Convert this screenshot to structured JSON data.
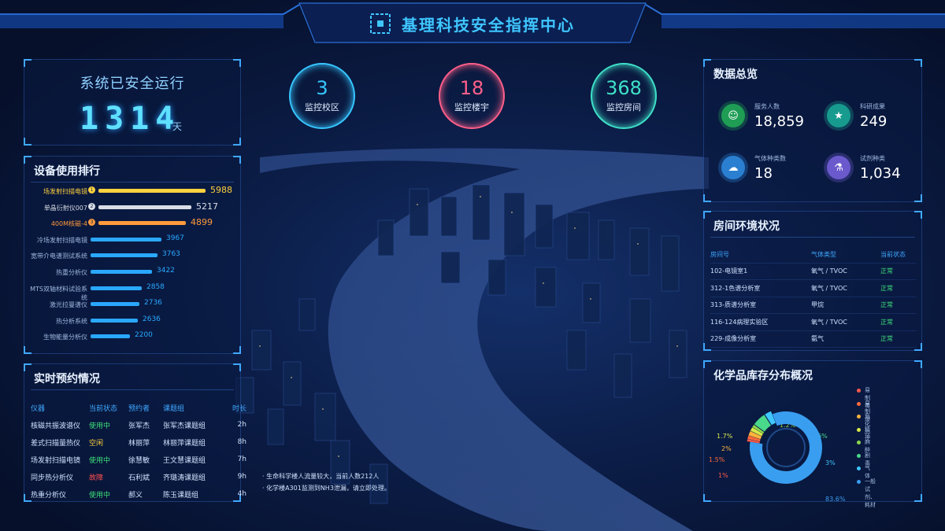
{
  "header": {
    "title": "基理科技安全指挥中心"
  },
  "safety": {
    "label": "系统已安全运行",
    "days": "1314",
    "unit": "天"
  },
  "stats": [
    {
      "value": "3",
      "label": "监控校区",
      "color": "#36c6ff"
    },
    {
      "value": "18",
      "label": "监控楼宇",
      "color": "#ff5f8a"
    },
    {
      "value": "368",
      "label": "监控房间",
      "color": "#3ee0c8"
    }
  ],
  "ranking": {
    "title": "设备使用排行",
    "max": 5988,
    "items": [
      {
        "name": "场发射扫描电镜",
        "value": 5988,
        "color": "#ffd23f",
        "medal": "1"
      },
      {
        "name": "单晶衍射仪007",
        "value": 5217,
        "color": "#d9dde6",
        "medal": "2"
      },
      {
        "name": "400M核磁-4",
        "value": 4899,
        "color": "#ff9a3c",
        "medal": "3"
      },
      {
        "name": "冷场发射扫描电镜",
        "value": 3967,
        "color": "#2aa8ff"
      },
      {
        "name": "宽带介电谱测试系统",
        "value": 3763,
        "color": "#2aa8ff"
      },
      {
        "name": "热重分析仪",
        "value": 3422,
        "color": "#2aa8ff"
      },
      {
        "name": "MTS双轴材料试验系统",
        "value": 2858,
        "color": "#2aa8ff"
      },
      {
        "name": "激光拉曼谱仪",
        "value": 2736,
        "color": "#2aa8ff"
      },
      {
        "name": "热分析系统",
        "value": 2636,
        "color": "#2aa8ff"
      },
      {
        "name": "生物能量分析仪",
        "value": 2200,
        "color": "#2aa8ff"
      }
    ]
  },
  "reservations": {
    "title": "实时预约情况",
    "headers": [
      "仪器",
      "当前状态",
      "预约者",
      "课题组",
      "时长"
    ],
    "rows": [
      {
        "device": "核磁共振波谱仪",
        "status": "使用中",
        "status_color": "#3ee07a",
        "user": "张军杰",
        "group": "张军杰课题组",
        "dur": "2h"
      },
      {
        "device": "差式扫描量热仪",
        "status": "空闲",
        "status_color": "#ffd23f",
        "user": "林丽萍",
        "group": "林丽萍课题组",
        "dur": "8h"
      },
      {
        "device": "场发射扫描电镜",
        "status": "使用中",
        "status_color": "#3ee07a",
        "user": "徐慧敏",
        "group": "王文慧课题组",
        "dur": "7h"
      },
      {
        "device": "同步热分析仪",
        "status": "故障",
        "status_color": "#ff4f4f",
        "user": "石利斌",
        "group": "齐璐涛课题组",
        "dur": "9h"
      },
      {
        "device": "热重分析仪",
        "status": "使用中",
        "status_color": "#3ee07a",
        "user": "郝义",
        "group": "陈玉课题组",
        "dur": "4h"
      }
    ]
  },
  "alerts": [
    "· 生命科学楼人流量较大，当前人数212人",
    "· 化学楼A301监测到NH3泄漏，请立即处理。"
  ],
  "overview": {
    "title": "数据总览",
    "items": [
      {
        "label": "服务人数",
        "value": "18,859",
        "icon": "people-icon",
        "color": "#1f9d55"
      },
      {
        "label": "科研成果",
        "value": "249",
        "icon": "trophy-icon",
        "color": "#179b8f"
      },
      {
        "label": "气体种类数",
        "value": "18",
        "icon": "gas-icon",
        "color": "#2b7fd1"
      },
      {
        "label": "试剂种类",
        "value": "1,034",
        "icon": "reagent-icon",
        "color": "#6a5acd"
      }
    ]
  },
  "environment": {
    "title": "房间环境状况",
    "headers": [
      "房间号",
      "气体类型",
      "当前状态"
    ],
    "rows": [
      {
        "room": "102-电镜室1",
        "gas": "氧气 / TVOC",
        "state": "正常"
      },
      {
        "room": "312-1色谱分析室",
        "gas": "氧气 / TVOC",
        "state": "正常"
      },
      {
        "room": "313-质谱分析室",
        "gas": "甲烷",
        "state": "正常"
      },
      {
        "room": "116-124病理实验区",
        "gas": "氧气 / TVOC",
        "state": "正常"
      },
      {
        "room": "229-成像分析室",
        "gas": "氨气",
        "state": "正常"
      }
    ]
  },
  "chemicals": {
    "title": "化学品库存分布概况",
    "chart_data": {
      "type": "pie",
      "slices": [
        {
          "name": "易制毒",
          "value": 1,
          "label": "1%",
          "color": "#ff5a4a"
        },
        {
          "name": "易制爆",
          "value": 1.5,
          "label": "1.5%",
          "color": "#ff6a3c"
        },
        {
          "name": "危化品",
          "value": 2,
          "label": "2%",
          "color": "#ffb43c"
        },
        {
          "name": "精神",
          "value": 1.7,
          "label": "1.7%",
          "color": "#d8e84a"
        },
        {
          "name": "麻醉",
          "value": 1.2,
          "label": "1.2%",
          "color": "#8fd84a"
        },
        {
          "name": "剧毒",
          "value": 6,
          "label": "6%",
          "color": "#4ad88a"
        },
        {
          "name": "气体",
          "value": 3,
          "label": "3%",
          "color": "#3fc6ff"
        },
        {
          "name": "一般试剂、耗材",
          "value": 83.6,
          "label": "83.6%",
          "color": "#3a9ef0"
        }
      ]
    }
  }
}
